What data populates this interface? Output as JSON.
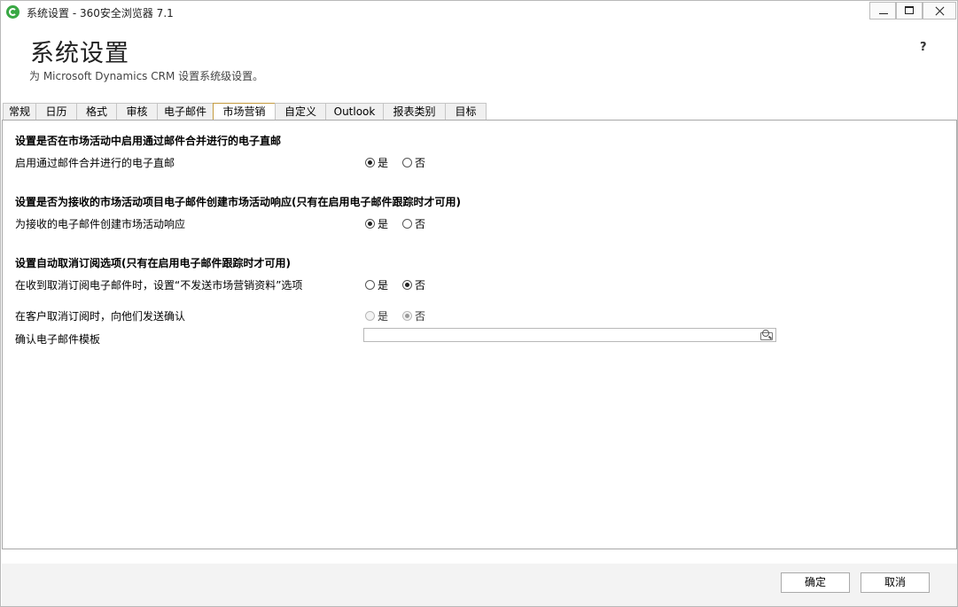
{
  "window": {
    "title": "系统设置 - 360安全浏览器 7.1"
  },
  "header": {
    "title": "系统设置",
    "subtitle": "为 Microsoft Dynamics CRM 设置系统级设置。",
    "help": "?"
  },
  "tabs": [
    {
      "label": "常规"
    },
    {
      "label": "日历"
    },
    {
      "label": "格式"
    },
    {
      "label": "审核"
    },
    {
      "label": "电子邮件"
    },
    {
      "label": "市场营销",
      "active": true
    },
    {
      "label": "自定义"
    },
    {
      "label": "Outlook"
    },
    {
      "label": "报表类别"
    },
    {
      "label": "目标"
    }
  ],
  "sections": [
    {
      "title": "设置是否在市场活动中启用通过邮件合并进行的电子直邮",
      "rows": [
        {
          "label": "启用通过邮件合并进行的电子直邮",
          "value": "是",
          "disabled": false
        }
      ]
    },
    {
      "title": "设置是否为接收的市场活动项目电子邮件创建市场活动响应(只有在启用电子邮件跟踪时才可用)",
      "rows": [
        {
          "label": "为接收的电子邮件创建市场活动响应",
          "value": "是",
          "disabled": false
        }
      ]
    },
    {
      "title": "设置自动取消订阅选项(只有在启用电子邮件跟踪时才可用)",
      "rows": [
        {
          "label": "在收到取消订阅电子邮件时，设置“不发送市场营销资料”选项",
          "value": "否",
          "disabled": false
        },
        {
          "label": "在客户取消订阅时，向他们发送确认",
          "value": "否",
          "disabled": true
        }
      ],
      "lookup_label": "确认电子邮件模板",
      "lookup_value": ""
    }
  ],
  "radio_options": {
    "yes": "是",
    "no": "否"
  },
  "footer": {
    "ok": "确定",
    "cancel": "取消"
  },
  "icons": {
    "app": "360-browser-icon",
    "lookup": "lookup-search-icon"
  }
}
